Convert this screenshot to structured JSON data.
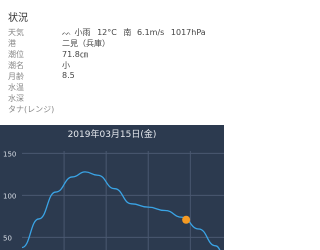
{
  "section_title": "状況",
  "info": {
    "weather": {
      "label": "天気",
      "icon": "rain-icon",
      "icon_glyph": "ᨓ",
      "condition": "小雨",
      "temperature": "12°C",
      "wind_dir": "南",
      "wind_speed": "6.1m/s",
      "pressure": "1017hPa"
    },
    "port": {
      "label": "港",
      "value": "二見（兵庫）"
    },
    "tide_level": {
      "label": "潮位",
      "value": "71.8㎝"
    },
    "tide_name": {
      "label": "潮名",
      "value": "小"
    },
    "moon_age": {
      "label": "月齢",
      "value": "8.5"
    },
    "water_temp": {
      "label": "水温",
      "value": ""
    },
    "water_depth": {
      "label": "水深",
      "value": ""
    },
    "tana": {
      "label": "タナ(レンジ)",
      "value": ""
    }
  },
  "chart_data": {
    "type": "line",
    "title": "2019年03月15日(金)",
    "yticks": [
      150,
      100,
      50
    ],
    "ylim": [
      35,
      160
    ],
    "xlim": [
      0,
      24
    ],
    "series": [
      {
        "x": [
          0,
          2,
          4,
          6,
          7.5,
          9,
          11,
          13,
          15,
          17,
          19,
          21,
          23,
          24
        ],
        "values": [
          38,
          72,
          104,
          122,
          128,
          124,
          108,
          90,
          86,
          82,
          74,
          60,
          40,
          30
        ]
      }
    ],
    "marker": {
      "x": 19.5,
      "value": 71
    },
    "colors": {
      "background": "#2c3a4f",
      "line": "#3aa4e6",
      "marker": "#f59a23",
      "grid": "#4a5870",
      "axis_text": "#d8dde5"
    }
  }
}
